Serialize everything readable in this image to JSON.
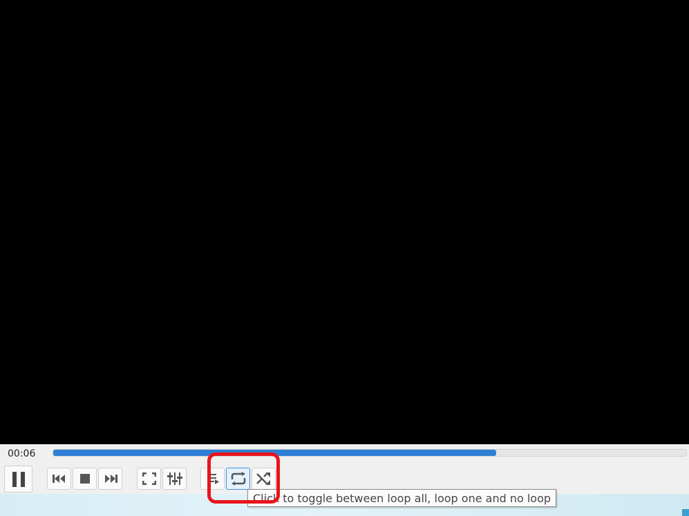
{
  "player": {
    "elapsed_time": "00:06",
    "progress": 0.7
  },
  "buttons": {
    "pause": "pause",
    "previous": "previous",
    "stop": "stop",
    "next": "next",
    "fullscreen": "fullscreen",
    "extended_settings": "extended settings",
    "playlist": "playlist",
    "loop": "loop",
    "random": "random"
  },
  "icons": [
    "pause-icon",
    "previous-icon",
    "stop-icon",
    "next-icon",
    "fullscreen-icon",
    "extended-settings-icon",
    "playlist-icon",
    "loop-icon",
    "random-icon"
  ],
  "tooltip": {
    "text": "Click to toggle between loop all, loop one and no loop"
  },
  "colors": {
    "accent": "#2d7fd6",
    "highlight_ring": "#e8141c",
    "video_bg": "#000000",
    "toolbar_bg": "#f0f0f0"
  }
}
